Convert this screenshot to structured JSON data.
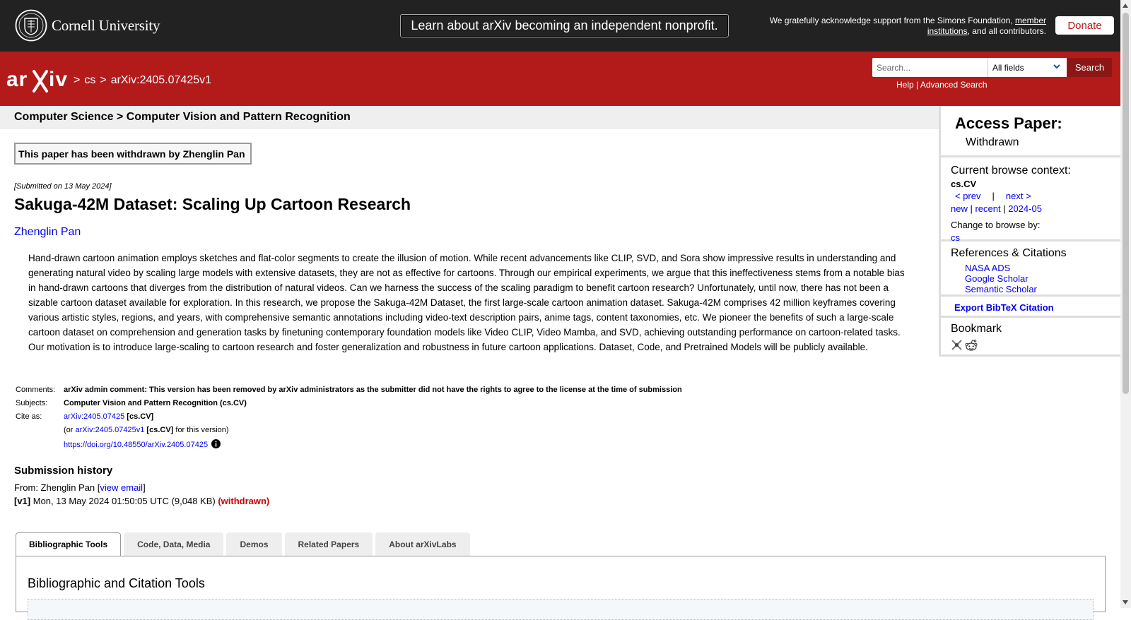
{
  "topbar": {
    "institution": "Cornell University",
    "nonprofit_banner": "Learn about arXiv becoming an independent nonprofit.",
    "ack_prefix": "We gratefully acknowledge support from the Simons Foundation, ",
    "ack_link": "member institutions",
    "ack_suffix": ", and all contributors.",
    "donate_label": "Donate"
  },
  "header": {
    "breadcrumb_sep1": ">",
    "breadcrumb_cs": "cs",
    "breadcrumb_sep2": ">",
    "breadcrumb_id": "arXiv:2405.07425v1",
    "search_placeholder": "Search...",
    "search_field": "All fields",
    "search_button": "Search",
    "help_link": "Help",
    "help_sep": " | ",
    "advanced_link": "Advanced Search"
  },
  "subject_header": "Computer Science > Computer Vision and Pattern Recognition",
  "withdrawn_notice": "This paper has been withdrawn by Zhenglin Pan",
  "submitted": "[Submitted on 13 May 2024]",
  "title": "Sakuga-42M Dataset: Scaling Up Cartoon Research",
  "author": "Zhenglin Pan",
  "abstract": "Hand-drawn cartoon animation employs sketches and flat-color segments to create the illusion of motion. While recent advancements like CLIP, SVD, and Sora show impressive results in understanding and generating natural video by scaling large models with extensive datasets, they are not as effective for cartoons. Through our empirical experiments, we argue that this ineffectiveness stems from a notable bias in hand-drawn cartoons that diverges from the distribution of natural videos. Can we harness the success of the scaling paradigm to benefit cartoon research? Unfortunately, until now, there has not been a sizable cartoon dataset available for exploration. In this research, we propose the Sakuga-42M Dataset, the first large-scale cartoon animation dataset. Sakuga-42M comprises 42 million keyframes covering various artistic styles, regions, and years, with comprehensive semantic annotations including video-text description pairs, anime tags, content taxonomies, etc. We pioneer the benefits of such a large-scale cartoon dataset on comprehension and generation tasks by finetuning contemporary foundation models like Video CLIP, Video Mamba, and SVD, achieving outstanding performance on cartoon-related tasks. Our motivation is to introduce large-scaling to cartoon research and foster generalization and robustness in future cartoon applications. Dataset, Code, and Pretrained Models will be publicly available.",
  "meta": {
    "comments_label": "Comments:",
    "comments": "arXiv admin comment: This version has been removed by arXiv administrators as the submitter did not have the rights to agree to the license at the time of submission",
    "subjects_label": "Subjects:",
    "subjects": "Computer Vision and Pattern Recognition (cs.CV)",
    "cite_label": "Cite as:",
    "cite_id": "arXiv:2405.07425",
    "cite_cat": "[cs.CV]",
    "cite_or": "(or ",
    "cite_version": "arXiv:2405.07425v1",
    "cite_version_cat": "[cs.CV]",
    "cite_version_suffix": " for this version)",
    "doi": "https://doi.org/10.48550/arXiv.2405.07425"
  },
  "history": {
    "title": "Submission history",
    "from_prefix": "From: Zhenglin Pan [",
    "view_email": "view email",
    "from_suffix": "]",
    "v1_label": "[v1]",
    "v1_date": " Mon, 13 May 2024 01:50:05 UTC (9,048 KB) ",
    "v1_status": "(withdrawn)"
  },
  "tabs": [
    "Bibliographic Tools",
    "Code, Data, Media",
    "Demos",
    "Related Papers",
    "About arXivLabs"
  ],
  "tab_panel_title": "Bibliographic and Citation Tools",
  "sidebar": {
    "access_title": "Access Paper:",
    "access_status": "Withdrawn",
    "context_title": "Current browse context:",
    "context_cat": "cs.CV",
    "prev": "< prev",
    "nav_sep": "|",
    "next": "next >",
    "new": "new",
    "sep": " | ",
    "recent": "recent",
    "month": "2024-05",
    "change_label": "Change to browse by:",
    "change_cs": "cs",
    "refs_title": "References & Citations",
    "refs": [
      "NASA ADS",
      "Google Scholar",
      "Semantic Scholar"
    ],
    "bibtex": "Export BibTeX Citation",
    "bookmark_title": "Bookmark"
  },
  "colors": {
    "brand_red": "#b31b1b",
    "top_dark": "#222222",
    "link": "#0000ee",
    "withdrawn_red": "#cc0000"
  },
  "icons": [
    "cornell-seal-icon",
    "arxiv-logo-icon",
    "chevron-down-icon",
    "info-icon",
    "bibsonomy-icon",
    "reddit-icon"
  ]
}
